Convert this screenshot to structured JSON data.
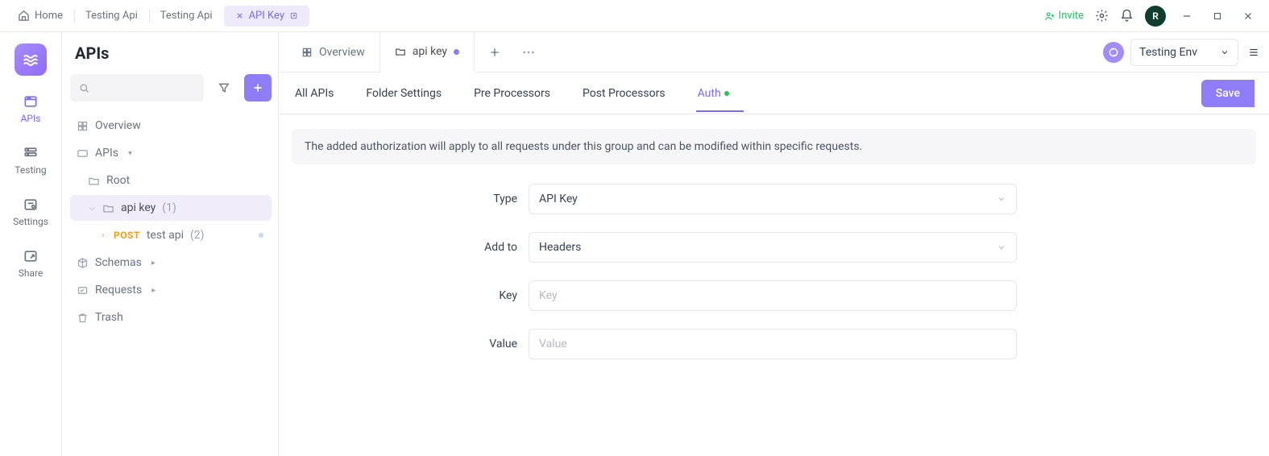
{
  "topbar": {
    "tabs": [
      {
        "label": "Home"
      },
      {
        "label": "Testing Api"
      },
      {
        "label": "Testing Api"
      },
      {
        "label": "API Key",
        "active": true
      }
    ],
    "invite_label": "Invite",
    "avatar_initial": "R"
  },
  "rail": {
    "items": [
      {
        "label": "APIs",
        "active": true
      },
      {
        "label": "Testing"
      },
      {
        "label": "Settings"
      },
      {
        "label": "Share"
      }
    ]
  },
  "sidebar": {
    "title": "APIs",
    "overview_label": "Overview",
    "apis_label": "APIs",
    "root_label": "Root",
    "apikey_label": "api key",
    "apikey_count": "(1)",
    "testapi_method": "POST",
    "testapi_label": "test api",
    "testapi_count": "(2)",
    "schemas_label": "Schemas",
    "requests_label": "Requests",
    "trash_label": "Trash"
  },
  "content_tabs": {
    "overview_label": "Overview",
    "apikey_label": "api key"
  },
  "env": {
    "label": "Testing Env"
  },
  "subnav": {
    "all_apis": "All APIs",
    "folder_settings": "Folder Settings",
    "pre_processors": "Pre Processors",
    "post_processors": "Post Processors",
    "auth": "Auth",
    "save": "Save"
  },
  "form": {
    "info": "The added authorization will apply to all requests under this group and can be modified within specific requests.",
    "type_label": "Type",
    "type_value": "API Key",
    "addto_label": "Add to",
    "addto_value": "Headers",
    "key_label": "Key",
    "key_placeholder": "Key",
    "value_label": "Value",
    "value_placeholder": "Value"
  }
}
